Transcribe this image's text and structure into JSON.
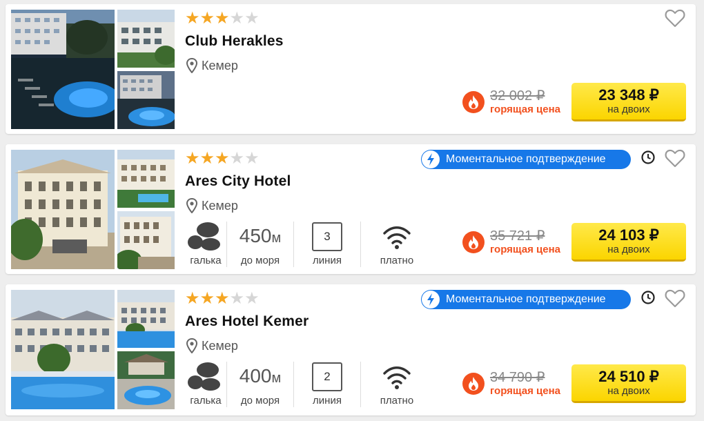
{
  "colors": {
    "star_on": "#f5a623",
    "star_off": "#d6d6d6",
    "hot": "#f2501e",
    "instant": "#1778e8",
    "button": "#fbd500"
  },
  "hotels": [
    {
      "name": "Club Herakles",
      "stars": 3,
      "location": "Кемер",
      "instant": null,
      "old_price": "32 002 ₽",
      "hot_label": "горящая цена",
      "price": "23 348 ₽",
      "price_for": "на двоих",
      "features": null
    },
    {
      "name": "Ares City Hotel",
      "stars": 3,
      "location": "Кемер",
      "instant": "Моментальное подтверждение",
      "old_price": "35 721 ₽",
      "hot_label": "горящая цена",
      "price": "24 103 ₽",
      "price_for": "на двоих",
      "features": {
        "beach_label": "галька",
        "distance_value": "450",
        "distance_unit": "м",
        "distance_label": "до моря",
        "line_value": "3",
        "line_label": "линия",
        "wifi_label": "платно"
      }
    },
    {
      "name": "Ares Hotel Kemer",
      "stars": 3,
      "location": "Кемер",
      "instant": "Моментальное подтверждение",
      "old_price": "34 790 ₽",
      "hot_label": "горящая цена",
      "price": "24 510 ₽",
      "price_for": "на двоих",
      "features": {
        "beach_label": "галька",
        "distance_value": "400",
        "distance_unit": "м",
        "distance_label": "до моря",
        "line_value": "2",
        "line_label": "линия",
        "wifi_label": "платно"
      }
    }
  ],
  "icons": {
    "star": "star-icon",
    "location": "location-pin-icon",
    "favorite": "heart-icon",
    "clock": "clock-icon",
    "bolt": "lightning-icon",
    "fire": "fire-icon",
    "beach": "pebble-icon",
    "wifi": "wifi-icon"
  }
}
